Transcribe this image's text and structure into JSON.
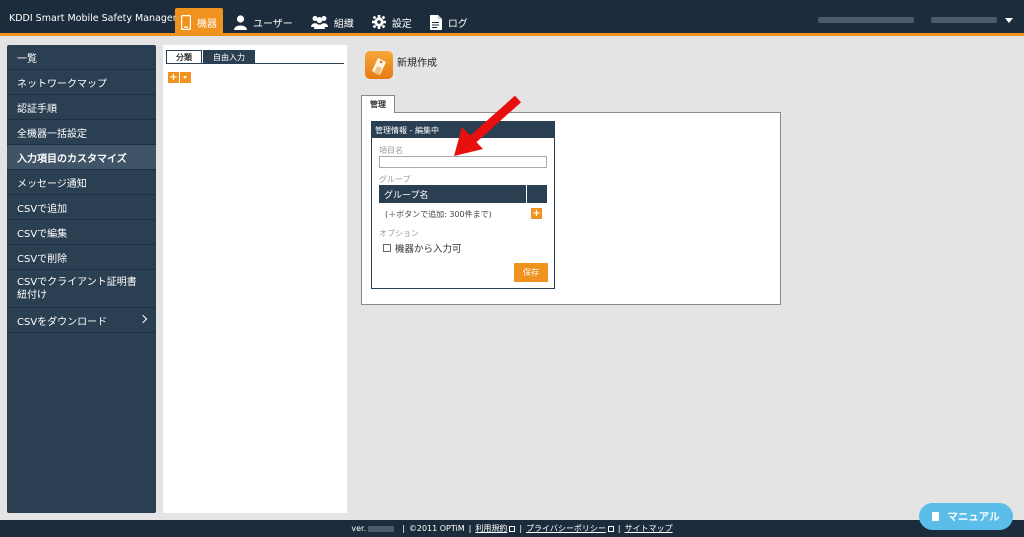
{
  "brand": "KDDI Smart Mobile Safety Manager",
  "nav": [
    {
      "label": "機器",
      "icon": "smartphone-icon",
      "active": true
    },
    {
      "label": "ユーザー",
      "icon": "user-icon",
      "active": false
    },
    {
      "label": "組織",
      "icon": "group-icon",
      "active": false
    },
    {
      "label": "設定",
      "icon": "gear-icon",
      "active": false
    },
    {
      "label": "ログ",
      "icon": "document-icon",
      "active": false
    }
  ],
  "sidebar": {
    "items": [
      {
        "label": "一覧"
      },
      {
        "label": "ネットワークマップ"
      },
      {
        "label": "認証手順"
      },
      {
        "label": "全機器一括設定"
      },
      {
        "label": "入力項目のカスタマイズ"
      },
      {
        "label": "メッセージ通知"
      },
      {
        "label": "CSVで追加"
      },
      {
        "label": "CSVで編集"
      },
      {
        "label": "CSVで削除"
      },
      {
        "label": "CSVでクライアント証明書紐付け"
      },
      {
        "label": "CSVをダウンロード"
      }
    ]
  },
  "middle": {
    "tabs": [
      {
        "label": "分類"
      },
      {
        "label": "自由入力"
      }
    ],
    "add_symbol": "+"
  },
  "main": {
    "title": "新規作成",
    "tab": "管理",
    "card": {
      "header": "管理情報 - 編集中",
      "item_name_label": "項目名",
      "item_name_value": "",
      "group_label": "グループ",
      "group_column": "グループ名",
      "group_hint": "(＋ボタンで追加: 300件まで)",
      "add_symbol": "+",
      "option_label": "オプション",
      "checkbox_label": "機器から入力可",
      "checkbox_checked": false,
      "save_label": "保存"
    }
  },
  "footer": {
    "ver": "ver.",
    "copyright": "©2011 OPTiM",
    "terms": "利用規約",
    "privacy": "プライバシーポリシー",
    "sitemap": "サイトマップ",
    "separator": "|"
  },
  "manual_button": "マニュアル",
  "colors": {
    "accent": "#f0931e",
    "navy": "#1c2c3c",
    "sidebar": "#2b3f52",
    "annotation_arrow": "#e8100e",
    "manual": "#5bbde8"
  }
}
